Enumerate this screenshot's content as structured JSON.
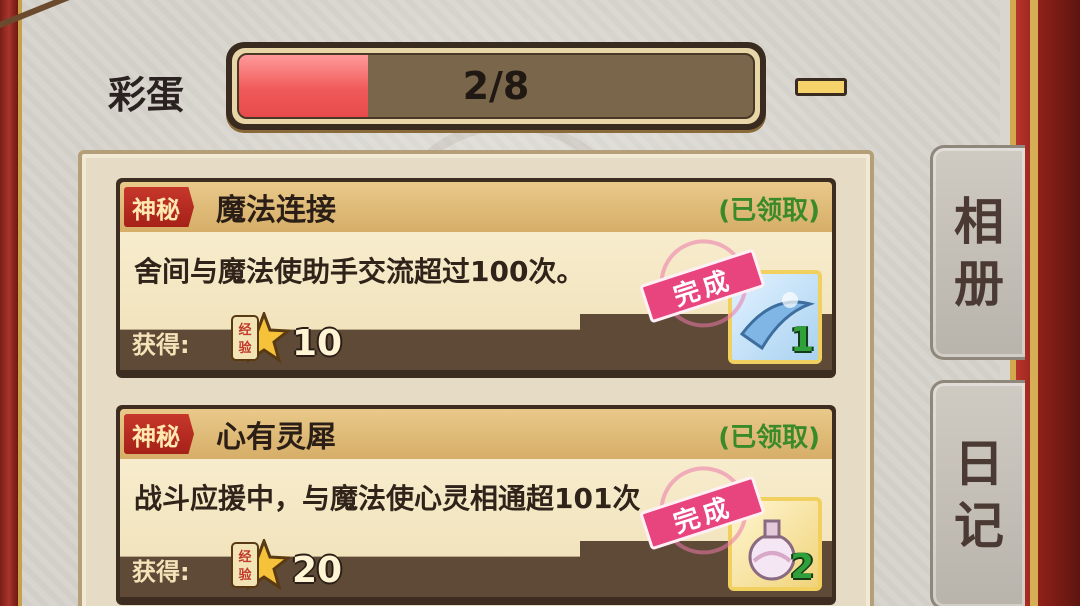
{
  "header": {
    "title": "彩蛋",
    "progress": {
      "text": "2/8",
      "fraction": 0.25
    }
  },
  "side_tabs": {
    "album": [
      "相",
      "册"
    ],
    "diary": [
      "日",
      "记"
    ]
  },
  "quests": [
    {
      "tag": "神秘",
      "title": "魔法连接",
      "status": "(已领取)",
      "description": "舍间与魔法使助手交流超过100次。",
      "reward_label": "获得:",
      "exp_icon_text": "经验",
      "exp_value": "10",
      "item_count": "1",
      "stamp": "完成",
      "item_icon": "blue-crystal-item-icon"
    },
    {
      "tag": "神秘",
      "title": "心有灵犀",
      "status": "(已领取)",
      "description": "战斗应援中，与魔法使心灵相通超101次",
      "reward_label": "获得:",
      "exp_icon_text": "经验",
      "exp_value": "20",
      "item_count": "2",
      "stamp": "完成",
      "item_icon": "perfume-bottle-item-icon"
    }
  ],
  "colors": {
    "progress_fill": "#f05a5a",
    "badge_red": "#c7372b",
    "claimed_green": "#3a8a2a",
    "stamp_pink": "#e8457f"
  }
}
